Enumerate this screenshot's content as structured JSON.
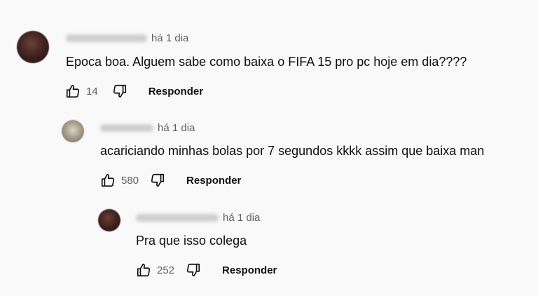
{
  "comments": [
    {
      "timestamp": "há 1 dia",
      "text": "Epoca boa. Alguem sabe como baixa o FIFA 15 pro pc hoje em dia????",
      "likes": "14",
      "reply_label": "Responder",
      "avatar_icon": "user-avatar-icon"
    },
    {
      "timestamp": "há 1 dia",
      "text": "acariciando minhas bolas por 7 segundos kkkk assim que baixa man",
      "likes": "580",
      "reply_label": "Responder",
      "avatar_icon": "user-avatar-icon"
    },
    {
      "timestamp": "há 1 dia",
      "text": "Pra que isso colega",
      "likes": "252",
      "reply_label": "Responder",
      "avatar_icon": "user-avatar-icon"
    }
  ]
}
